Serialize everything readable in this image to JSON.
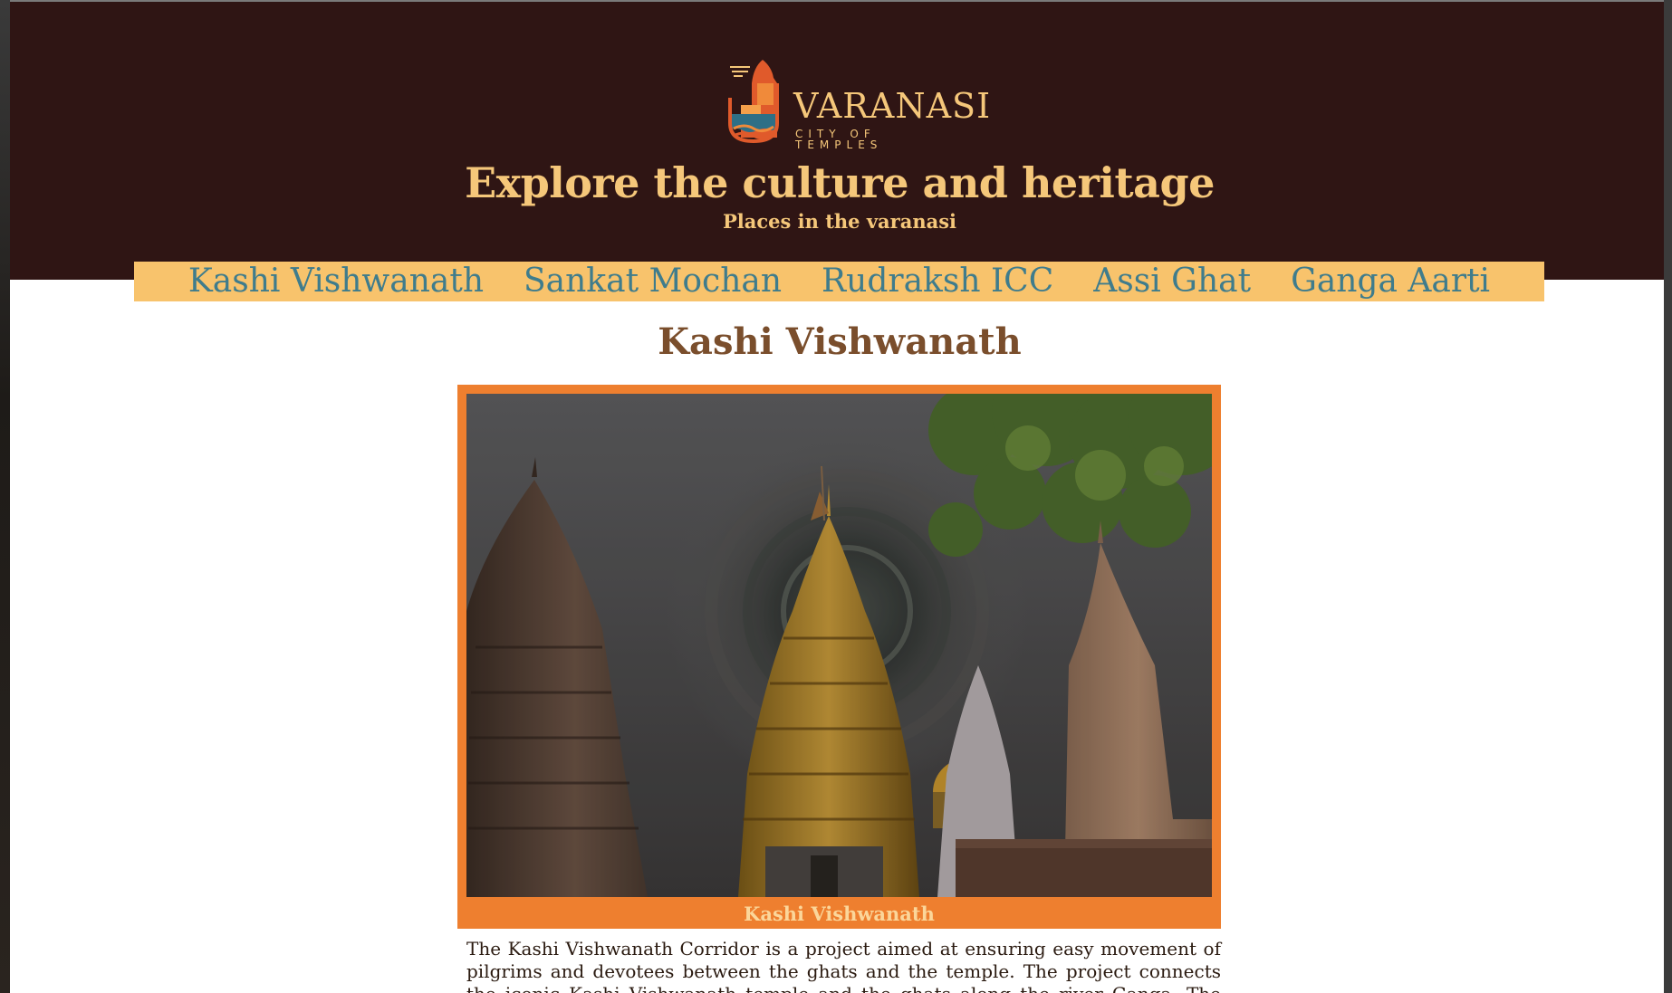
{
  "logo": {
    "icon": "temple-logo-icon",
    "wordmark": "VARANASI",
    "tagline": "CITY OF TEMPLES"
  },
  "hero": {
    "title": "Explore the culture and heritage",
    "subtitle": "Places in the varanasi"
  },
  "nav": {
    "items": [
      {
        "label": "Kashi Vishwanath"
      },
      {
        "label": "Sankat Mochan"
      },
      {
        "label": "Rudraksh ICC"
      },
      {
        "label": "Assi Ghat"
      },
      {
        "label": "Ganga Aarti"
      }
    ]
  },
  "section": {
    "title": "Kashi Vishwanath",
    "image_caption": "Kashi Vishwanath",
    "description": "The Kashi Vishwanath Corridor is a project aimed at ensuring easy movement of pilgrims and devotees between the ghats and the temple. The project connects the iconic Kashi Vishwanath temple and the ghats along the river Ganga. The corridor is"
  },
  "colors": {
    "hero_bg": "#2f1514",
    "accent_gold": "#f5c77a",
    "nav_bg": "#f8c36c",
    "nav_text": "#3f7c8c",
    "section_title": "#7a4e2c",
    "frame": "#ee7f2f"
  }
}
